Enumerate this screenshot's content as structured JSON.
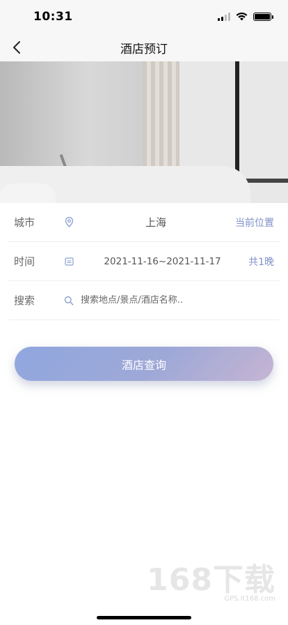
{
  "status_bar": {
    "time": "10:31"
  },
  "nav": {
    "title": "酒店预订"
  },
  "form": {
    "city": {
      "label": "城市",
      "value": "上海",
      "action": "当前位置"
    },
    "date": {
      "label": "时间",
      "value": "2021-11-16~2021-11-17",
      "nights": "共1晚"
    },
    "search": {
      "label": "搜索",
      "placeholder": "搜索地点/景点/酒店名称.."
    }
  },
  "cta": {
    "label": "酒店查询"
  },
  "watermark": {
    "brand": "168下载",
    "site": "GPS.it168.com"
  },
  "colors": {
    "accent": "#7f91c8",
    "button_start": "#90a7de",
    "button_end": "#c6b5d3"
  },
  "icons": {
    "back": "chevron-left",
    "city": "location-pin",
    "date": "calendar",
    "search": "search"
  }
}
